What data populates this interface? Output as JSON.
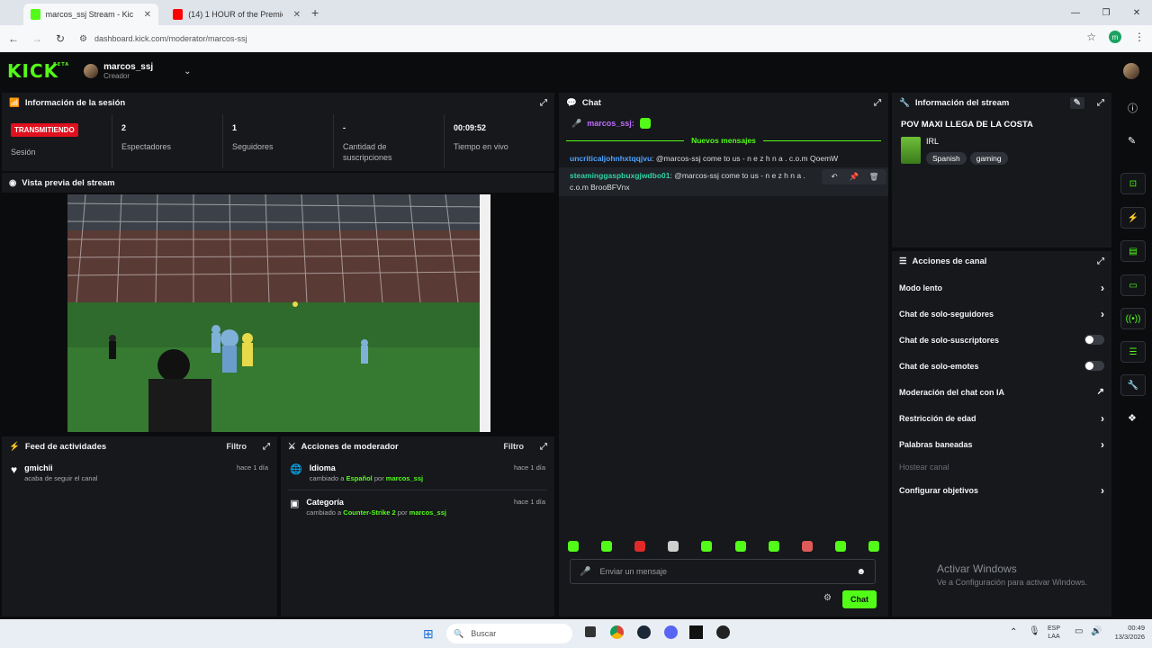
{
  "browser": {
    "tabs": [
      {
        "label": "marcos_ssj Stream - Kick Dashb",
        "color": "#53fc18"
      },
      {
        "label": "(14) 1 HOUR of the Premier Le",
        "color": "#ff0000"
      }
    ],
    "url": "dashboard.kick.com/moderator/marcos-ssj",
    "profile_initial": "m"
  },
  "header": {
    "logo": "KICK",
    "logo_tag": "BETA",
    "username": "marcos_ssj",
    "role": "Creador"
  },
  "session": {
    "title": "Información de la sesión",
    "badge": "TRANSMITIENDO",
    "stats": [
      {
        "value": "",
        "label": "Sesión"
      },
      {
        "value": "2",
        "label": "Espectadores"
      },
      {
        "value": "1",
        "label": "Seguidores"
      },
      {
        "value": "-",
        "label": "Cantidad de suscripciones"
      },
      {
        "value": "00:09:52",
        "label": "Tiempo en vivo"
      }
    ]
  },
  "preview": {
    "title": "Vista previa del stream"
  },
  "activity": {
    "title": "Feed de actividades",
    "filter": "Filtro",
    "items": [
      {
        "name": "gmichii",
        "sub": "acaba de seguir el canal",
        "time": "hace 1 día"
      }
    ]
  },
  "modactions": {
    "title": "Acciones de moderador",
    "filter": "Filtro",
    "items": [
      {
        "title": "Idioma",
        "prefix": "cambiado a",
        "value": "Español",
        "by": "por",
        "user": "marcos_ssj",
        "time": "hace 1 día"
      },
      {
        "title": "Categoría",
        "prefix": "cambiado a",
        "value": "Counter-Strike 2",
        "by": "por",
        "user": "marcos_ssj",
        "time": "hace 1 día"
      }
    ]
  },
  "chat": {
    "title": "Chat",
    "pinned_user": "marcos_ssj:",
    "divider": "Nuevos mensajes",
    "messages": [
      {
        "user": "uncriticaljohnhxtqqjvu",
        "text": ": @marcos-ssj come to us - n e z h n a . c.o.m QoemW",
        "color": "#4fa3ff"
      },
      {
        "user": "steaminggaspbuxgjwdbo01",
        "text": ": @marcos-ssj come to us - n e z h n a . c.o.m BrooBFVnx",
        "color": "#2fd3a6"
      }
    ],
    "input_placeholder": "Enviar un mensaje",
    "send_label": "Chat"
  },
  "streaminfo": {
    "title": "Información del stream",
    "stream_title": "POV MAXI LLEGA DE LA COSTA",
    "category": "IRL",
    "tags": [
      "Spanish",
      "gaming"
    ]
  },
  "channel_actions": {
    "title": "Acciones de canal",
    "rows": [
      {
        "label": "Modo lento",
        "kind": "arrow"
      },
      {
        "label": "Chat de solo-seguidores",
        "kind": "arrow"
      },
      {
        "label": "Chat de solo-suscriptores",
        "kind": "toggle"
      },
      {
        "label": "Chat de solo-emotes",
        "kind": "toggle"
      },
      {
        "label": "Moderación del chat con IA",
        "kind": "ext"
      },
      {
        "label": "Restricción de edad",
        "kind": "arrow"
      },
      {
        "label": "Palabras baneadas",
        "kind": "arrow"
      },
      {
        "label": "Hostear canal",
        "kind": "disabled"
      },
      {
        "label": "Configurar objetivos",
        "kind": "arrow"
      }
    ]
  },
  "watermark": {
    "line1": "Activar Windows",
    "line2": "Ve a Configuración para activar Windows."
  },
  "taskbar": {
    "search_placeholder": "Buscar",
    "lang": "ESP",
    "lang2": "LAA",
    "time": "00:49",
    "date": "13/3/2026"
  }
}
